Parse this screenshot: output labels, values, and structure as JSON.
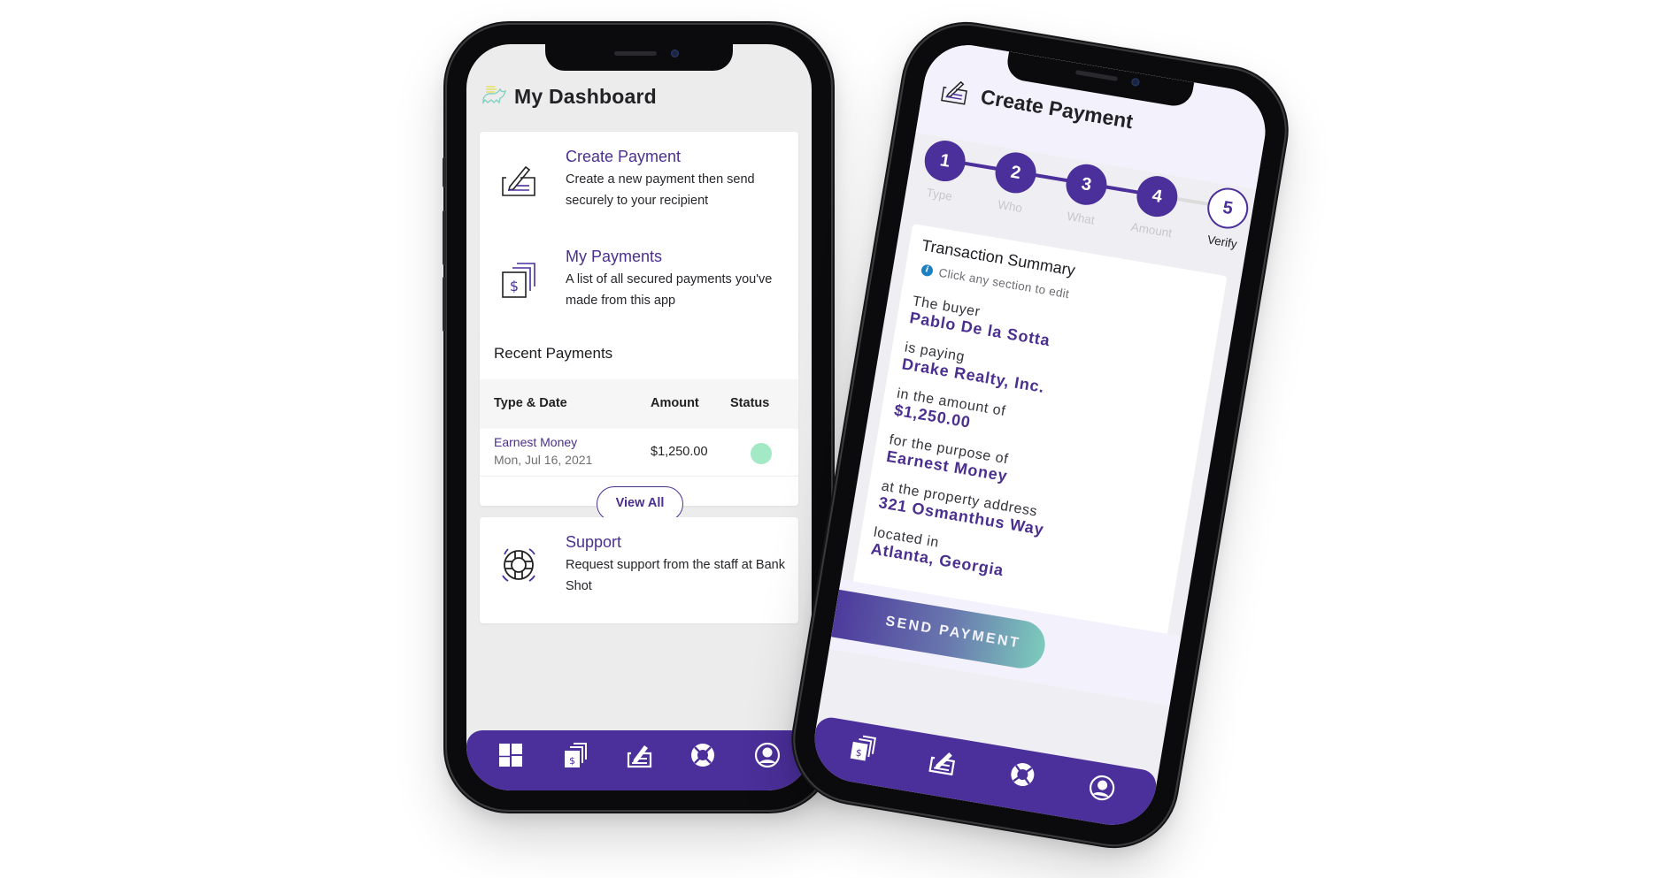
{
  "colors": {
    "brand_purple": "#4b2f9a",
    "text_purple": "#4b2f8f",
    "status_complete": "#a3e9c6",
    "info_blue": "#1c7fc4",
    "gradient_start": "#4d3a9c",
    "gradient_end": "#7ccbbc"
  },
  "dashboard": {
    "logo_icon": "rhino-logo-icon",
    "title": "My Dashboard",
    "cards": [
      {
        "icon": "check-sign-icon",
        "title": "Create Payment",
        "description": "Create a new payment then send securely to your recipient"
      },
      {
        "icon": "stacked-dollar-bills-icon",
        "title": "My Payments",
        "description": "A list of all secured payments you've made from this app"
      }
    ],
    "recent": {
      "title": "Recent Payments",
      "columns": [
        "Type & Date",
        "Amount",
        "Status"
      ],
      "rows": [
        {
          "type": "Earnest Money",
          "date": "Mon, Jul 16, 2021",
          "amount": "$1,250.00",
          "status": "complete"
        }
      ],
      "view_all_label": "View All"
    },
    "support": {
      "icon": "lifebuoy-icon",
      "title": "Support",
      "description": "Request support from the staff at Bank Shot"
    },
    "nav": [
      {
        "icon": "dashboard-grid-icon",
        "label": "Dashboard",
        "active": true
      },
      {
        "icon": "stacked-dollar-bills-icon",
        "label": "My Payments"
      },
      {
        "icon": "check-sign-icon",
        "label": "Create Payment"
      },
      {
        "icon": "lifebuoy-icon",
        "label": "Support"
      },
      {
        "icon": "user-circle-icon",
        "label": "Profile"
      }
    ]
  },
  "create_payment": {
    "header_icon": "check-sign-icon",
    "title": "Create Payment",
    "steps": [
      {
        "number": "1",
        "label": "Type",
        "state": "done"
      },
      {
        "number": "2",
        "label": "Who",
        "state": "done"
      },
      {
        "number": "3",
        "label": "What",
        "state": "done"
      },
      {
        "number": "4",
        "label": "Amount",
        "state": "done"
      },
      {
        "number": "5",
        "label": "Verify",
        "state": "current"
      }
    ],
    "summary": {
      "title": "Transaction Summary",
      "hint": "Click any section to edit",
      "items": [
        {
          "label": "The buyer",
          "value": "Pablo De la Sotta"
        },
        {
          "label": "is paying",
          "value": "Drake Realty, Inc."
        },
        {
          "label": "in the amount of",
          "value": "$1,250.00"
        },
        {
          "label": "for the purpose of",
          "value": "Earnest Money"
        },
        {
          "label": "at the property address",
          "value": "321 Osmanthus Way"
        },
        {
          "label": "located in",
          "value": "Atlanta, Georgia"
        }
      ]
    },
    "send_button_label": "SEND PAYMENT",
    "nav": [
      {
        "icon": "stacked-dollar-bills-icon",
        "label": "My Payments"
      },
      {
        "icon": "check-sign-icon",
        "label": "Create Payment"
      },
      {
        "icon": "lifebuoy-icon",
        "label": "Support"
      },
      {
        "icon": "user-circle-icon",
        "label": "Profile"
      }
    ]
  }
}
